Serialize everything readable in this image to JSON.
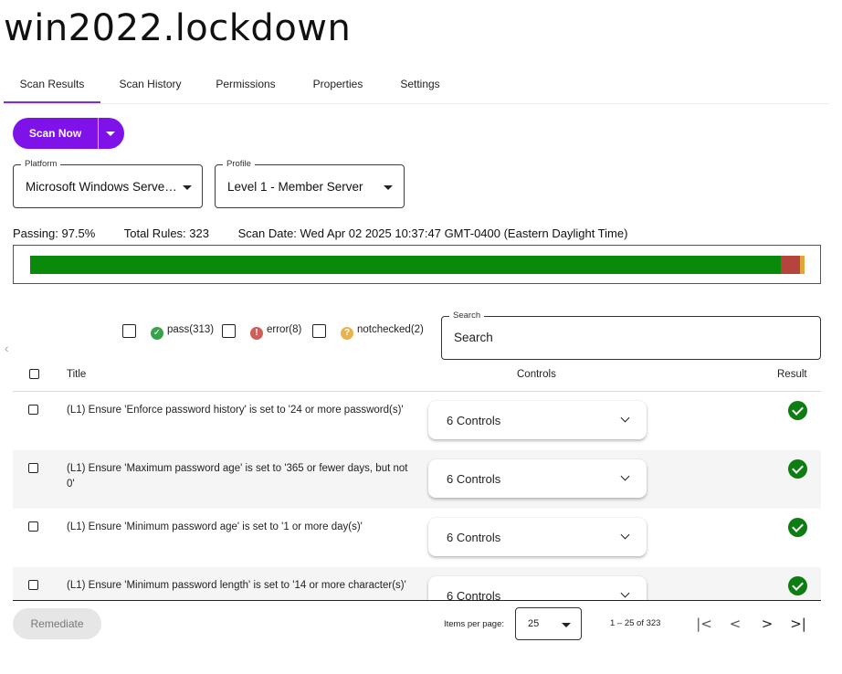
{
  "page": {
    "title": "win2022.lockdown"
  },
  "tabs": [
    {
      "label": "Scan Results",
      "active": true
    },
    {
      "label": "Scan History",
      "active": false
    },
    {
      "label": "Permissions",
      "active": false
    },
    {
      "label": "Properties",
      "active": false
    },
    {
      "label": "Settings",
      "active": false
    }
  ],
  "toolbar": {
    "scan_label": "Scan Now"
  },
  "platform": {
    "label": "Platform",
    "value": "Microsoft Windows Serve…"
  },
  "profile": {
    "label": "Profile",
    "value": "Level 1 - Member Server"
  },
  "stats": {
    "passing": "Passing: 97.5%",
    "total_rules": "Total Rules: 323",
    "scan_date": "Scan Date: Wed Apr 02 2025 10:37:47 GMT-0400 (Eastern Daylight Time)"
  },
  "progress": {
    "pass": 313,
    "error": 8,
    "notchecked": 2,
    "colors": {
      "pass": "#0a8a0a",
      "error": "#b5443c",
      "notchecked": "#e3a53b"
    }
  },
  "filters": {
    "pass": "pass(313)",
    "error": "error(8)",
    "notchecked": "notchecked(2)",
    "icons": {
      "pass": "check-circle-icon",
      "error": "exclamation-circle-icon",
      "notchecked": "question-circle-icon"
    }
  },
  "search": {
    "label": "Search",
    "placeholder": "Search"
  },
  "table": {
    "headers": {
      "title": "Title",
      "controls": "Controls",
      "result": "Result"
    },
    "rows": [
      {
        "title": "(L1) Ensure 'Enforce password history' is set to '24 or more password(s)'",
        "controls": "6 Controls",
        "result": "pass"
      },
      {
        "title": "(L1) Ensure 'Maximum password age' is set to '365 or fewer days, but not 0'",
        "controls": "6 Controls",
        "result": "pass"
      },
      {
        "title": "(L1) Ensure 'Minimum password age' is set to '1 or more day(s)'",
        "controls": "6 Controls",
        "result": "pass"
      },
      {
        "title": "(L1) Ensure 'Minimum password length' is set to '14 or more character(s)'",
        "controls": "6 Controls",
        "result": "pass"
      }
    ]
  },
  "footer": {
    "remediate_label": "Remediate",
    "items_per_page_label": "Items per page:",
    "items_per_page_value": "25",
    "range": "1 – 25 of 323",
    "first": "|<",
    "prev": "<",
    "next": ">",
    "last": ">|"
  }
}
